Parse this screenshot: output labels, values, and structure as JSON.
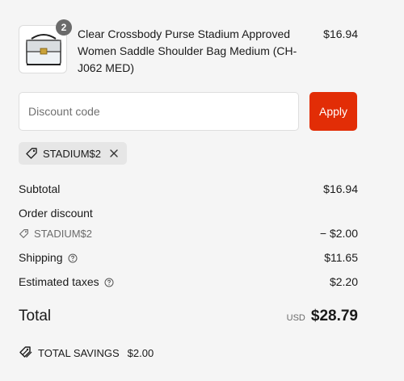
{
  "line_item": {
    "quantity": "2",
    "title": "Clear Crossbody Purse Stadium Approved Women Saddle Shoulder Bag Medium (CH-J062 MED)",
    "price": "$16.94"
  },
  "discount_form": {
    "placeholder": "Discount code",
    "apply_label": "Apply"
  },
  "applied_code": {
    "code": "STADIUM$2"
  },
  "summary": {
    "subtotal_label": "Subtotal",
    "subtotal_value": "$16.94",
    "order_discount_label": "Order discount",
    "discount_code": "STADIUM$2",
    "discount_value": "− $2.00",
    "shipping_label": "Shipping",
    "shipping_value": "$11.65",
    "taxes_label": "Estimated taxes",
    "taxes_value": "$2.20",
    "total_label": "Total",
    "currency": "USD",
    "total_value": "$28.79"
  },
  "savings": {
    "label": "TOTAL SAVINGS",
    "amount": "$2.00"
  },
  "colors": {
    "apply_button": "#e22d06",
    "background": "#f5f5f5",
    "badge": "#6b6b6b"
  }
}
